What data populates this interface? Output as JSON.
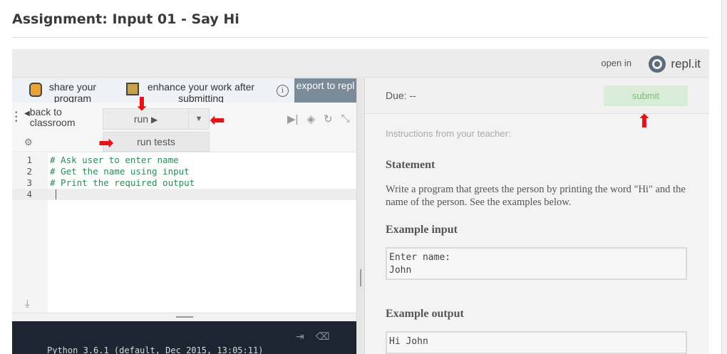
{
  "page": {
    "title": "Assignment: Input 01 - Say Hi"
  },
  "topbar": {
    "open_in": "open in",
    "brand": "repl.it",
    "brand_icon": "replit-logo-icon"
  },
  "promo": {
    "share_label": "share your program",
    "enhance_label": "enhance your work after submitting",
    "export_label": "export to repl"
  },
  "toolbar": {
    "back_label": "back to classroom",
    "run_label": "run",
    "run_tests_label": "run tests",
    "icons": [
      "step-forward-icon",
      "package-icon",
      "refresh-icon",
      "collapse-icon"
    ]
  },
  "editor": {
    "lines": [
      {
        "num": "1",
        "code": "# Ask user to enter name"
      },
      {
        "num": "2",
        "code": "# Get the name using input"
      },
      {
        "num": "3",
        "code": "# Print the required output"
      },
      {
        "num": "4",
        "code": ""
      }
    ]
  },
  "console": {
    "text": "Python 3.6.1 (default, Dec 2015, 13:05:11)"
  },
  "panel": {
    "due": "Due: --",
    "submit_label": "submit",
    "instructions_label": "Instructions from your teacher:",
    "statement_heading": "Statement",
    "statement_text": "Write a program that greets the person by printing the word \"Hi\" and the name of the person. See the examples below.",
    "example_input_heading": "Example input",
    "example_input": "Enter name:\nJohn",
    "example_output_heading": "Example output",
    "example_output": "Hi John"
  },
  "colors": {
    "export_bg": "#7a8a99",
    "submit_bg": "#d8ecd8",
    "submit_text": "#7dbb7d",
    "code_comment": "#2c8a55",
    "console_bg": "#1e2532",
    "annotation_red": "#e3131a"
  }
}
